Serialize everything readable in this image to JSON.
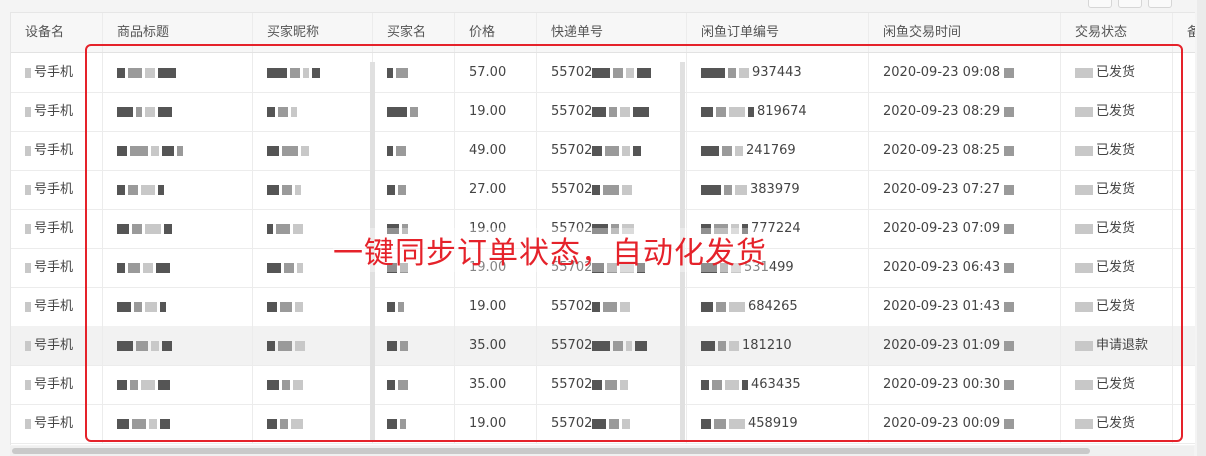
{
  "table": {
    "columns": [
      "设备名",
      "商品标题",
      "买家昵称",
      "买家名",
      "价格",
      "快递单号",
      "闲鱼订单编号",
      "闲鱼交易时间",
      "交易状态",
      "备"
    ],
    "rows": [
      {
        "device": "号手机",
        "price": "57.00",
        "tracking": "55702",
        "order_suffix": "937443",
        "time": "2020-09-23 09:08",
        "status": "已发货"
      },
      {
        "device": "号手机",
        "price": "19.00",
        "tracking": "55702",
        "order_suffix": "819674",
        "time": "2020-09-23 08:29",
        "status": "已发货"
      },
      {
        "device": "号手机",
        "price": "49.00",
        "tracking": "55702",
        "order_suffix": "241769",
        "time": "2020-09-23 08:25",
        "status": "已发货"
      },
      {
        "device": "号手机",
        "price": "27.00",
        "tracking": "55702",
        "order_suffix": "383979",
        "time": "2020-09-23 07:27",
        "status": "已发货"
      },
      {
        "device": "号手机",
        "price": "19.00",
        "tracking": "55702",
        "order_suffix": "777224",
        "time": "2020-09-23 07:09",
        "status": "已发货"
      },
      {
        "device": "号手机",
        "price": "19.00",
        "tracking": "55702",
        "order_suffix": "531499",
        "time": "2020-09-23 06:43",
        "status": "已发货"
      },
      {
        "device": "号手机",
        "price": "19.00",
        "tracking": "55702",
        "order_suffix": "684265",
        "time": "2020-09-23 01:43",
        "status": "已发货"
      },
      {
        "device": "号手机",
        "price": "35.00",
        "tracking": "55702",
        "order_suffix": "181210",
        "time": "2020-09-23 01:09",
        "status": "申请退款"
      },
      {
        "device": "号手机",
        "price": "35.00",
        "tracking": "55702",
        "order_suffix": "463435",
        "time": "2020-09-23 00:30",
        "status": "已发货"
      },
      {
        "device": "号手机",
        "price": "19.00",
        "tracking": "55702",
        "order_suffix": "458919",
        "time": "2020-09-23 00:09",
        "status": "已发货"
      }
    ]
  },
  "overlay": {
    "caption": "一键同步订单状态，自动化发货",
    "accent_color": "#e5222a"
  }
}
